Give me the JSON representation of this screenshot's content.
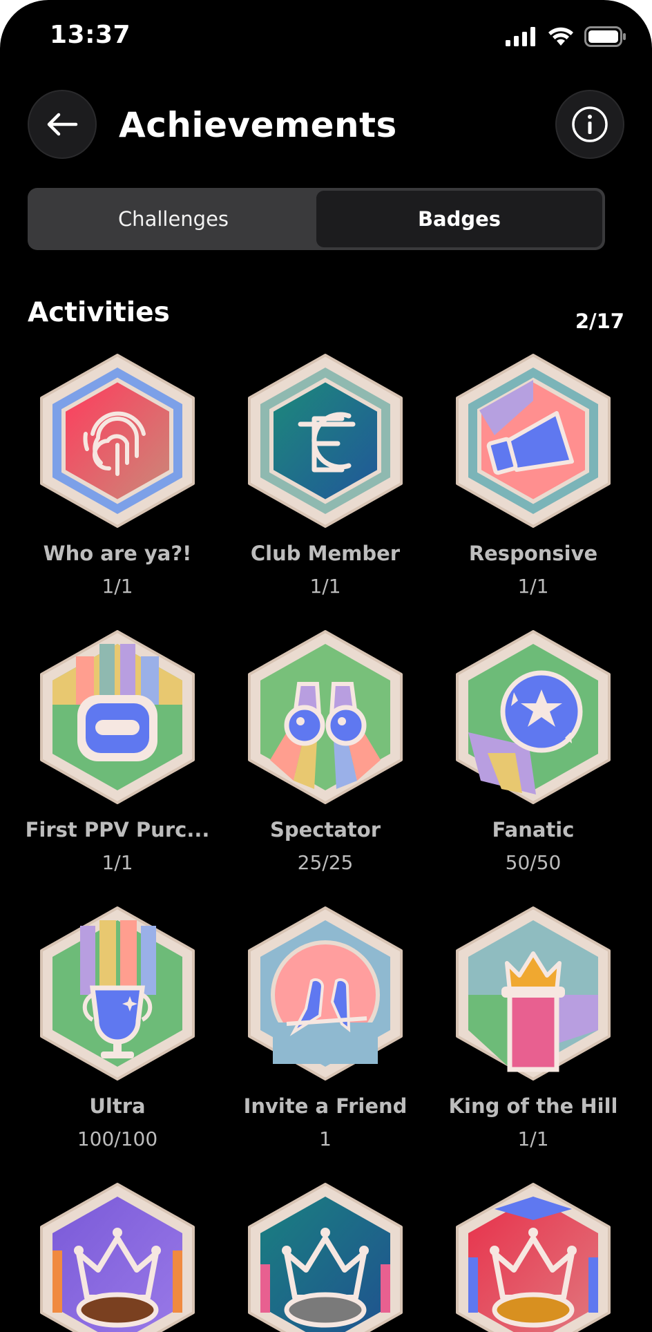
{
  "status": {
    "time": "13:37"
  },
  "header": {
    "title": "Achievements"
  },
  "tabs": [
    {
      "label": "Challenges",
      "active": false
    },
    {
      "label": "Badges",
      "active": true
    }
  ],
  "section": {
    "title": "Activities",
    "count": "2/17"
  },
  "badges": [
    {
      "name": "Who are ya?!",
      "progress": "1/1",
      "icon": "fingerprint-icon"
    },
    {
      "name": "Club Member",
      "progress": "1/1",
      "icon": "club-crest-icon"
    },
    {
      "name": "Responsive",
      "progress": "1/1",
      "icon": "megaphone-icon"
    },
    {
      "name": "First PPV Purc...",
      "progress": "1/1",
      "icon": "vr-headset-icon"
    },
    {
      "name": "Spectator",
      "progress": "25/25",
      "icon": "binoculars-icon"
    },
    {
      "name": "Fanatic",
      "progress": "50/50",
      "icon": "football-icon"
    },
    {
      "name": "Ultra",
      "progress": "100/100",
      "icon": "trophy-icon"
    },
    {
      "name": "Invite a Friend",
      "progress": "1",
      "icon": "birds-icon"
    },
    {
      "name": "King of the Hill",
      "progress": "1/1",
      "icon": "crown-pillar-icon"
    },
    {
      "name": "",
      "progress": "",
      "icon": "crown-bronze-icon"
    },
    {
      "name": "",
      "progress": "",
      "icon": "crown-silver-icon"
    },
    {
      "name": "",
      "progress": "",
      "icon": "crown-gold-icon"
    }
  ]
}
